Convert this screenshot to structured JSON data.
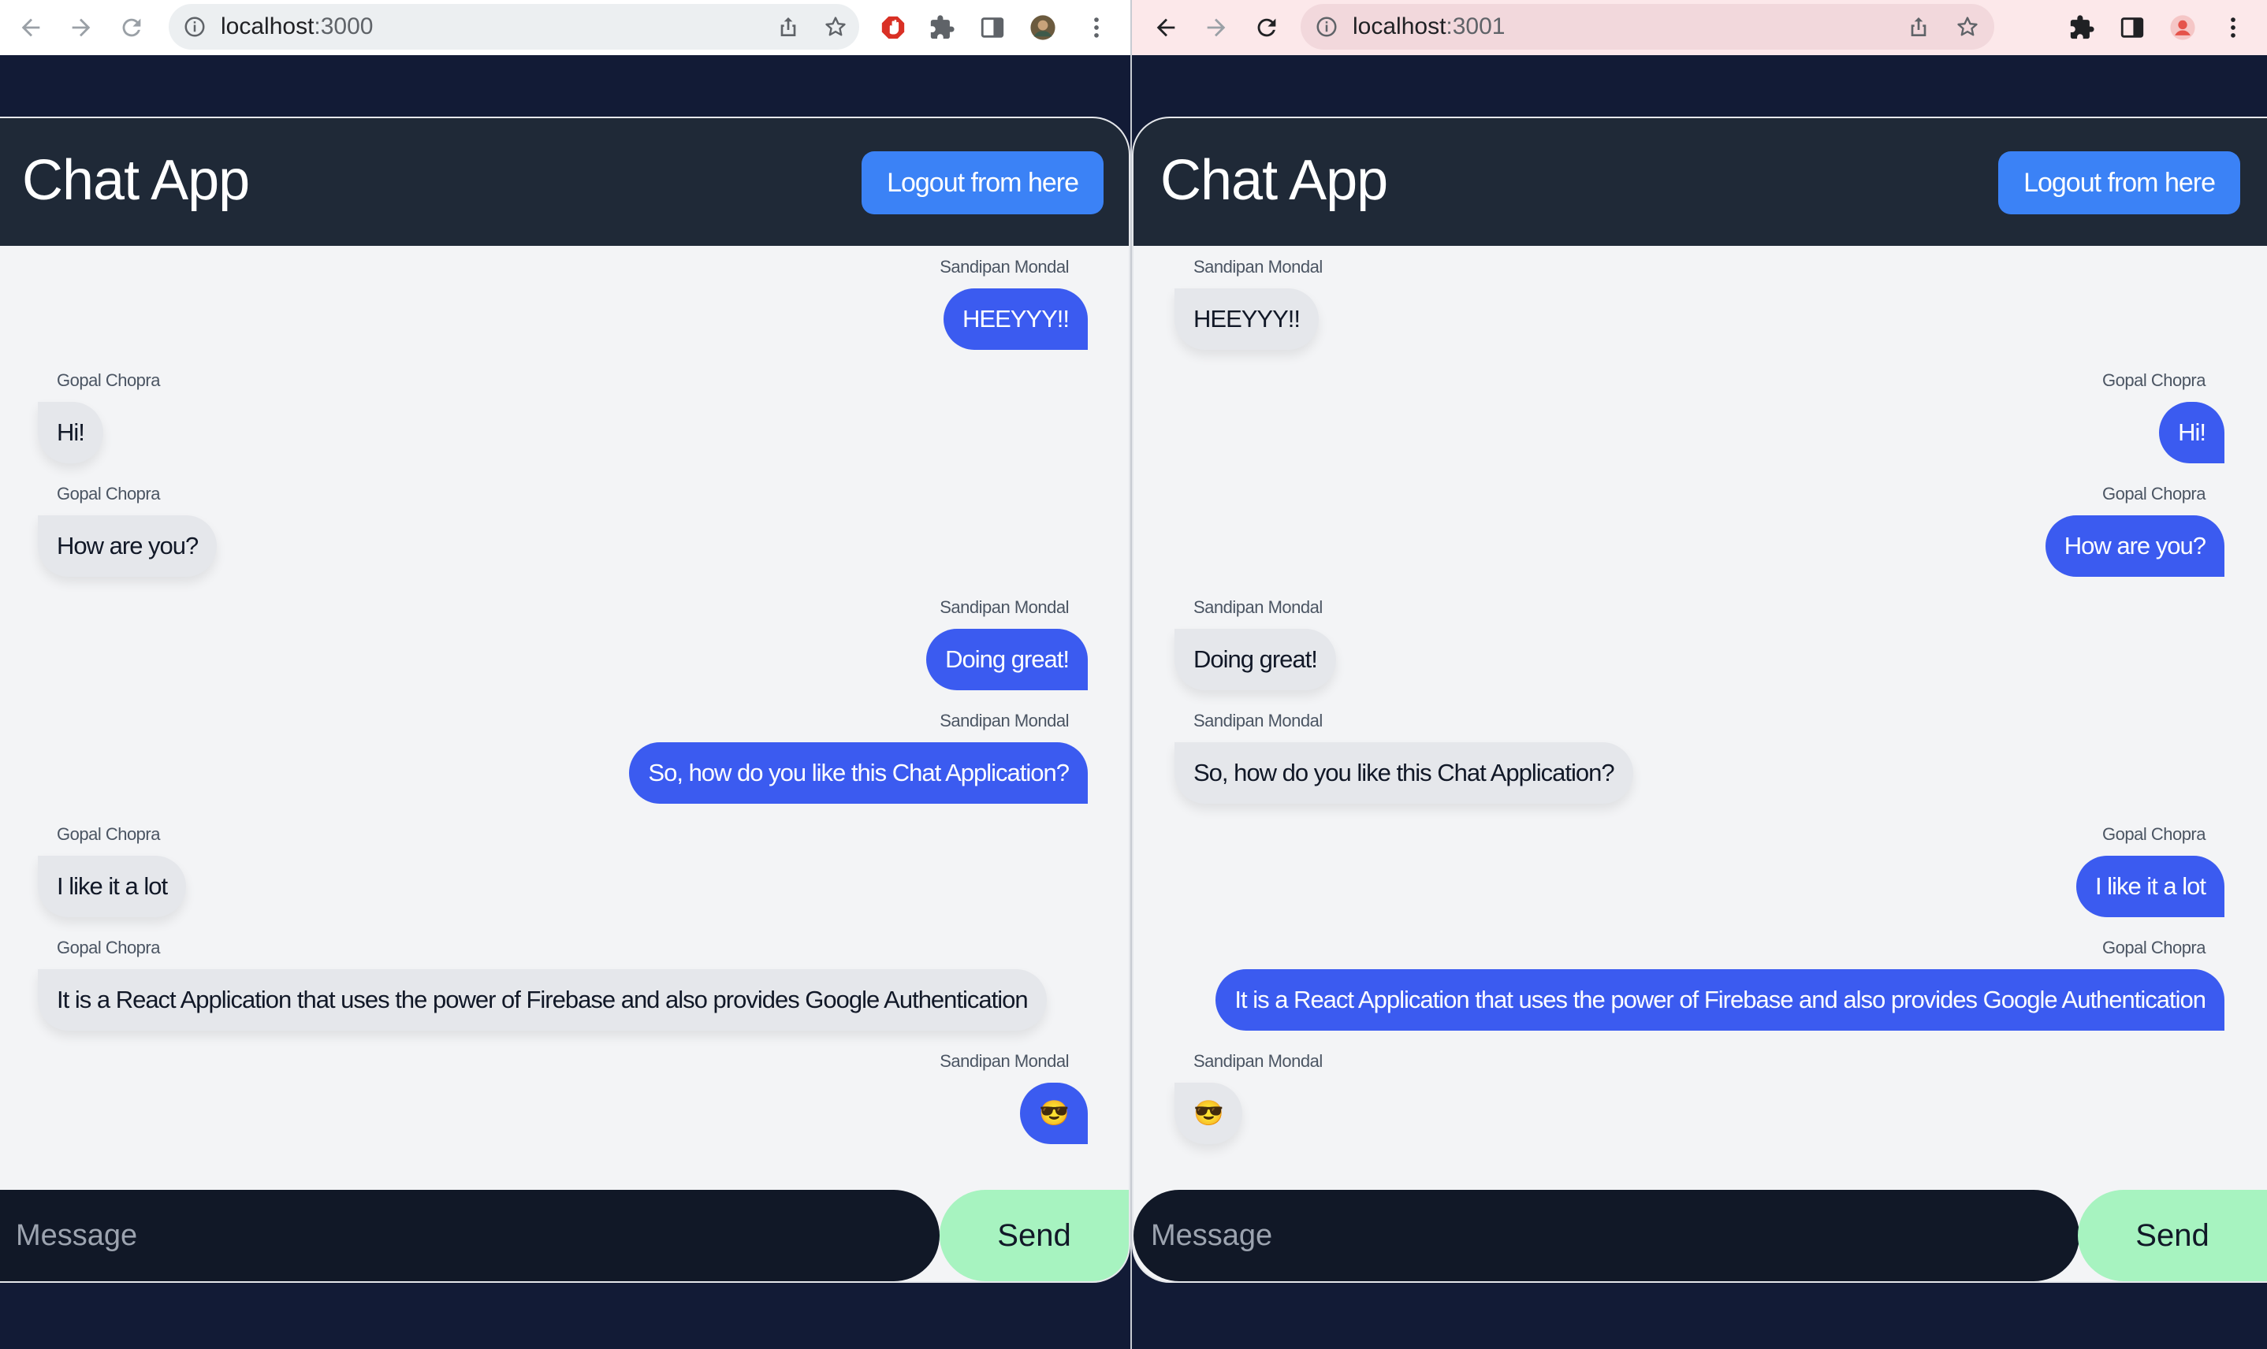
{
  "left": {
    "url": {
      "host": "localhost",
      "port": ":3000"
    },
    "app": {
      "title": "Chat App",
      "logout_label": "Logout from here",
      "messages": [
        {
          "author": "Sandipan Mondal",
          "text": "HEEYYY!!"
        },
        {
          "author": "Gopal Chopra",
          "text": "Hi!"
        },
        {
          "author": "Gopal Chopra",
          "text": "How are you?"
        },
        {
          "author": "Sandipan Mondal",
          "text": "Doing great!"
        },
        {
          "author": "Sandipan Mondal",
          "text": "So, how do you like this Chat Application?"
        },
        {
          "author": "Gopal Chopra",
          "text": "I like it a lot"
        },
        {
          "author": "Gopal Chopra",
          "text": "It is a React Application that uses the power of Firebase and also provides Google Authentication"
        },
        {
          "author": "Sandipan Mondal",
          "text": "😎"
        }
      ],
      "input_placeholder": "Message",
      "send_label": "Send"
    }
  },
  "right": {
    "url": {
      "host": "localhost",
      "port": ":3001"
    },
    "app": {
      "title": "Chat App",
      "logout_label": "Logout from here",
      "messages": [
        {
          "author": "Sandipan Mondal",
          "text": "HEEYYY!!"
        },
        {
          "author": "Gopal Chopra",
          "text": "Hi!"
        },
        {
          "author": "Gopal Chopra",
          "text": "How are you?"
        },
        {
          "author": "Sandipan Mondal",
          "text": "Doing great!"
        },
        {
          "author": "Sandipan Mondal",
          "text": "So, how do you like this Chat Application?"
        },
        {
          "author": "Gopal Chopra",
          "text": "I like it a lot"
        },
        {
          "author": "Gopal Chopra",
          "text": "It is a React Application that uses the power of Firebase and also provides Google Authentication"
        },
        {
          "author": "Sandipan Mondal",
          "text": "😎"
        }
      ],
      "input_placeholder": "Message",
      "send_label": "Send"
    }
  },
  "colors": {
    "page_bg": "#121b36",
    "header_bg": "#1f2937",
    "logout_bg": "#3b82f6",
    "own_bubble": "#3b5bf0",
    "other_bubble": "#e5e7eb",
    "send_bg": "#a7f3c0",
    "input_bg": "#111827"
  },
  "icons": {
    "toolbar": [
      "back-arrow-icon",
      "forward-arrow-icon",
      "reload-icon",
      "info-icon",
      "share-icon",
      "star-icon",
      "extension-icon",
      "side-panel-icon",
      "avatar-icon",
      "kebab-menu-icon"
    ]
  }
}
